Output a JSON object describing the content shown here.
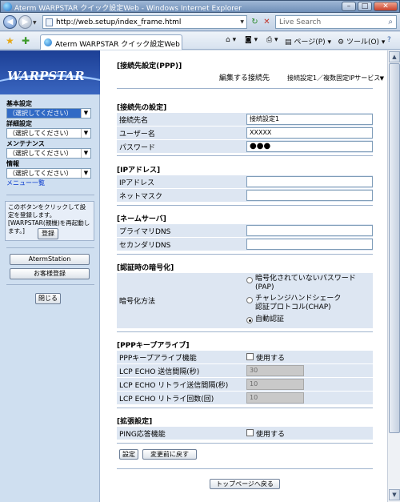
{
  "window": {
    "title": "Aterm WARPSTAR クイック設定Web - Windows Internet Explorer",
    "minimize": "–",
    "maximize": "□",
    "close": "✕"
  },
  "navbar": {
    "url": "http://web.setup/index_frame.html",
    "search_placeholder": "Live Search"
  },
  "cmdbar": {
    "tab_title": "Aterm WARPSTAR クイック設定Web",
    "page_menu": "ページ(P)",
    "tools_menu": "ツール(O)"
  },
  "sidebar": {
    "logo": "WARPSTAR",
    "menus": [
      {
        "label": "基本設定",
        "value": "（選択してください）"
      },
      {
        "label": "詳細設定",
        "value": "（選択してください）"
      },
      {
        "label": "メンテナンス",
        "value": "（選択してください）"
      },
      {
        "label": "情報",
        "value": "（選択してください）"
      }
    ],
    "menu_list_link": "メニュー一覧",
    "info_text": "このボタンをクリックして設定を登録します。[WARPSTAR(親機)を再起動します。]",
    "register_button": "登録",
    "aterm_station_button": "AtermStation",
    "customer_register_button": "お客様登録",
    "close_button": "閉じる"
  },
  "main": {
    "ppp_title": "[接続先設定(PPP)]",
    "edit_target_label": "編集する接続先",
    "edit_target_value": "接続設定1／複数固定IPサービス",
    "conn": {
      "title": "[接続先の設定]",
      "name_label": "接続先名",
      "name_value": "接続設定1",
      "user_label": "ユーザー名",
      "user_value": "XXXXX",
      "pass_label": "パスワード",
      "pass_value": "●●●"
    },
    "ip": {
      "title": "[IPアドレス]",
      "ip_label": "IPアドレス",
      "netmask_label": "ネットマスク"
    },
    "dns": {
      "title": "[ネームサーバ]",
      "primary_label": "プライマリDNS",
      "secondary_label": "セカンダリDNS"
    },
    "auth": {
      "title": "[認証時の暗号化]",
      "label": "暗号化方法",
      "option1": "暗号化されていないパスワード\n(PAP)",
      "option1_line1": "暗号化されていないパスワード",
      "option1_line2": "(PAP)",
      "option2_line1": "チャレンジハンドシェーク",
      "option2_line2": "認証プロトコル(CHAP)",
      "option3": "自動認証"
    },
    "keepalive": {
      "title": "[PPPキープアライブ]",
      "func_label": "PPPキープアライブ機能",
      "use_label": "使用する",
      "interval_label": "LCP ECHO 送信間隔(秒)",
      "interval_value": "30",
      "retry_interval_label": "LCP ECHO リトライ送信間隔(秒)",
      "retry_interval_value": "10",
      "retry_count_label": "LCP ECHO リトライ回数(回)",
      "retry_count_value": "10"
    },
    "ext": {
      "title": "[拡張設定]",
      "ping_label": "PING応答機能",
      "use_label": "使用する"
    },
    "set_button": "設定",
    "revert_button": "変更前に戻す",
    "top_button": "トップページへ戻る"
  }
}
